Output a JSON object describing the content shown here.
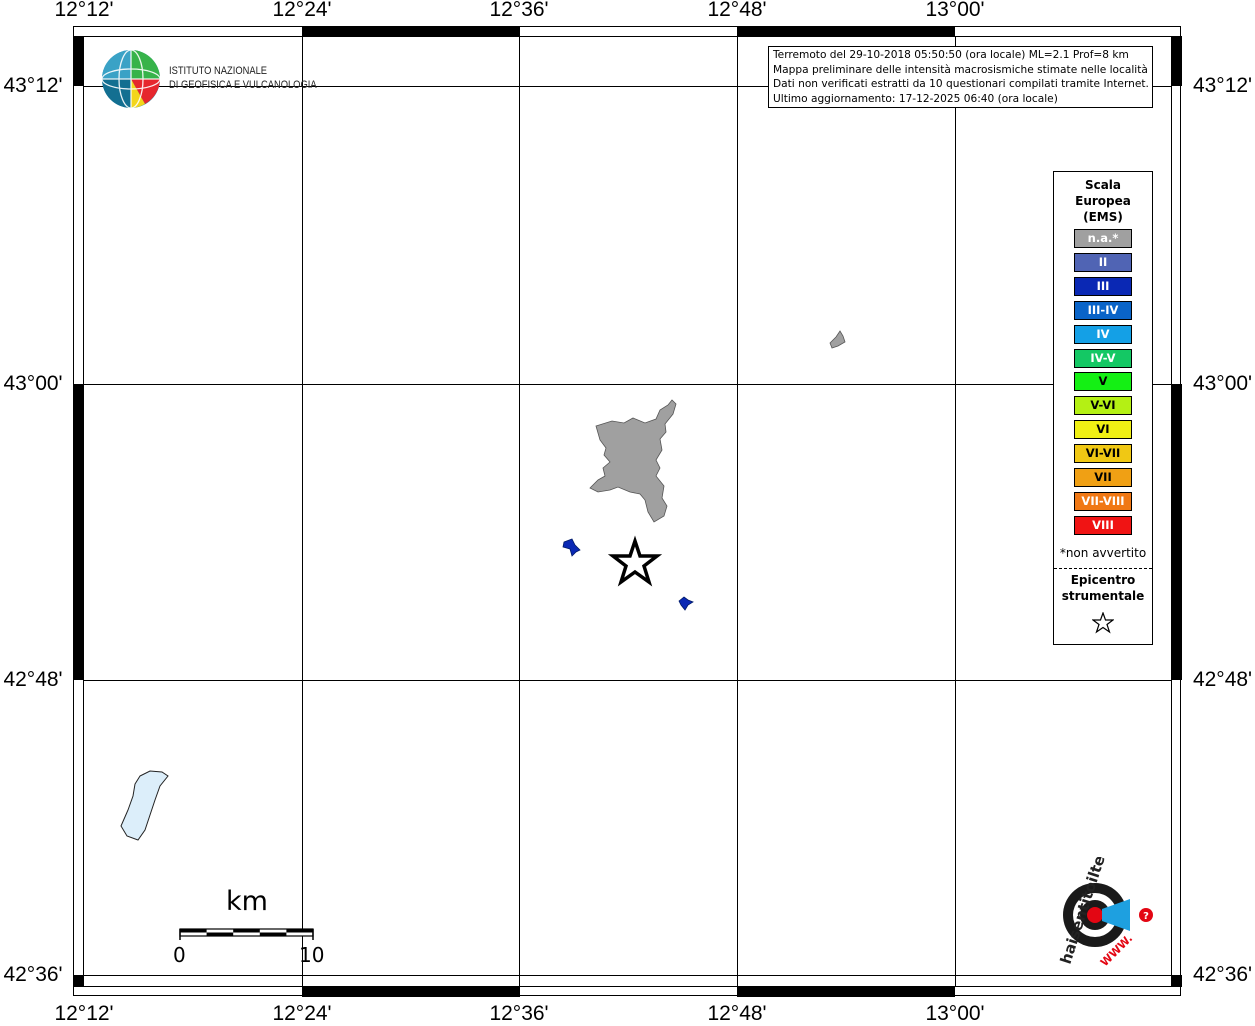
{
  "map": {
    "lon_labels": [
      "12°12'",
      "12°24'",
      "12°36'",
      "12°48'",
      "13°00'"
    ],
    "lat_labels": [
      "43°12'",
      "43°00'",
      "42°48'",
      "42°36'"
    ]
  },
  "info": {
    "line1": "Terremoto del 29-10-2018 05:50:50 (ora locale) ML=2.1 Prof=8 km",
    "line2": "Mappa preliminare delle intensità macrosismiche stimate nelle località",
    "line3": "Dati non verificati estratti da 10 questionari compilati tramite Internet.",
    "line4": "Ultimo aggiornamento: 17-12-2025 06:40 (ora locale)"
  },
  "logo": {
    "line1": "ISTITUTO NAZIONALE",
    "line2": "DI GEOFISICA E VULCANOLOGIA"
  },
  "legend": {
    "title1": "Scala",
    "title2": "Europea",
    "title3": "(EMS)",
    "classes": [
      {
        "label": "n.a.*",
        "color": "#a0a0a0"
      },
      {
        "label": "II",
        "color": "#5064b4"
      },
      {
        "label": "III",
        "color": "#0a28b4"
      },
      {
        "label": "III-IV",
        "color": "#0a64c8"
      },
      {
        "label": "IV",
        "color": "#14a0e6"
      },
      {
        "label": "IV-V",
        "color": "#14c864"
      },
      {
        "label": "V",
        "color": "#14f014"
      },
      {
        "label": "V-VI",
        "color": "#b4f014"
      },
      {
        "label": "VI",
        "color": "#f0f014"
      },
      {
        "label": "VI-VII",
        "color": "#f0c814"
      },
      {
        "label": "VII",
        "color": "#f0a014"
      },
      {
        "label": "VII-VIII",
        "color": "#f07814"
      },
      {
        "label": "VIII",
        "color": "#f01414"
      }
    ],
    "note": "*non avvertito",
    "epicenter1": "Epicentro",
    "epicenter2": "strumentale"
  },
  "scale": {
    "unit": "km",
    "start": "0",
    "end": "10"
  },
  "colors": {
    "na_fill": "#a0a0a0",
    "iii_fill": "#0a28b4",
    "lake_fill": "#dceefa"
  }
}
